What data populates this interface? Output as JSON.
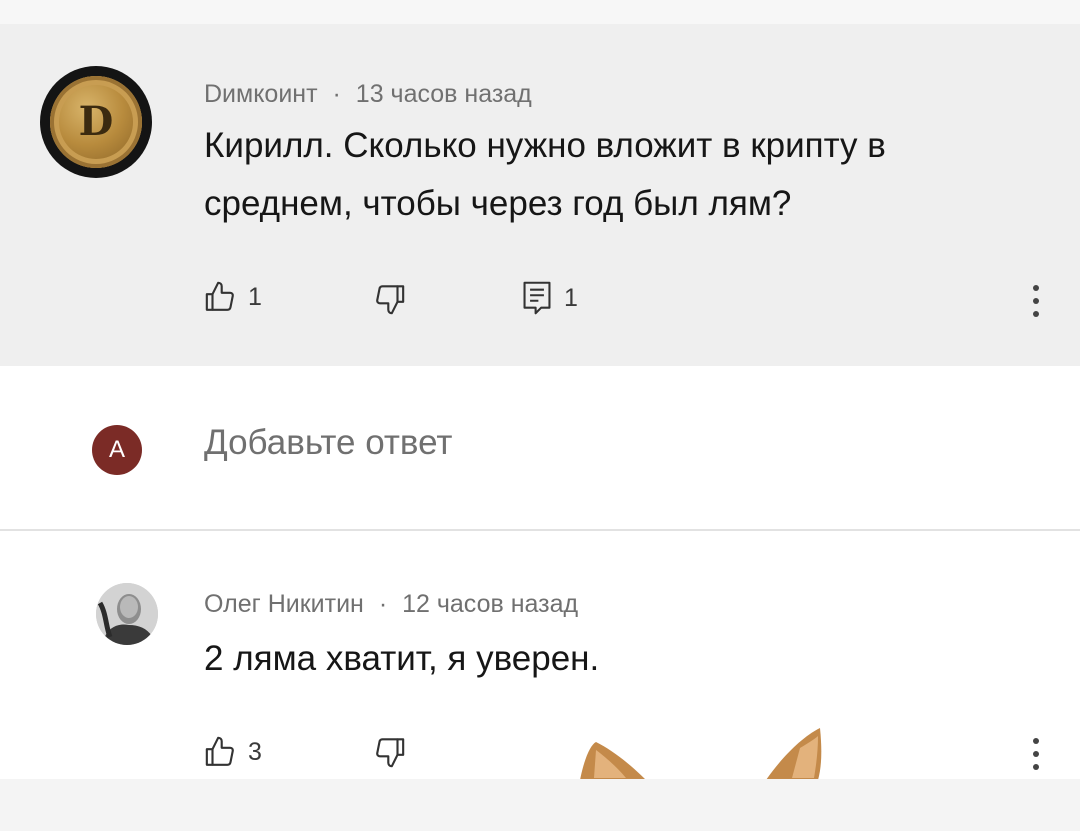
{
  "comment1": {
    "author": "Dимкоинт",
    "time": "13 часов назад",
    "avatar_letter": "D",
    "text_line1": "Кирилл. Сколько нужно вложит в крипту в",
    "text_line2": "среднем, чтобы через год был лям?",
    "likes": "1",
    "replies": "1",
    "icons": [
      "thumbs-up-icon",
      "thumbs-down-icon",
      "reply-icon",
      "more-vert-icon"
    ]
  },
  "reply_box": {
    "avatar_letter": "A",
    "placeholder": "Добавьте ответ"
  },
  "comment2": {
    "author": "Олег Никитин",
    "time": "12 часов назад",
    "text": "2 ляма хватит, я уверен.",
    "likes": "3",
    "icons": [
      "thumbs-up-icon",
      "thumbs-down-icon",
      "more-vert-icon"
    ]
  },
  "separator": "·",
  "colors": {
    "highlight_bg": "#efefef",
    "avatar_a_bg": "#7b2b26",
    "meta_text": "#707070"
  }
}
